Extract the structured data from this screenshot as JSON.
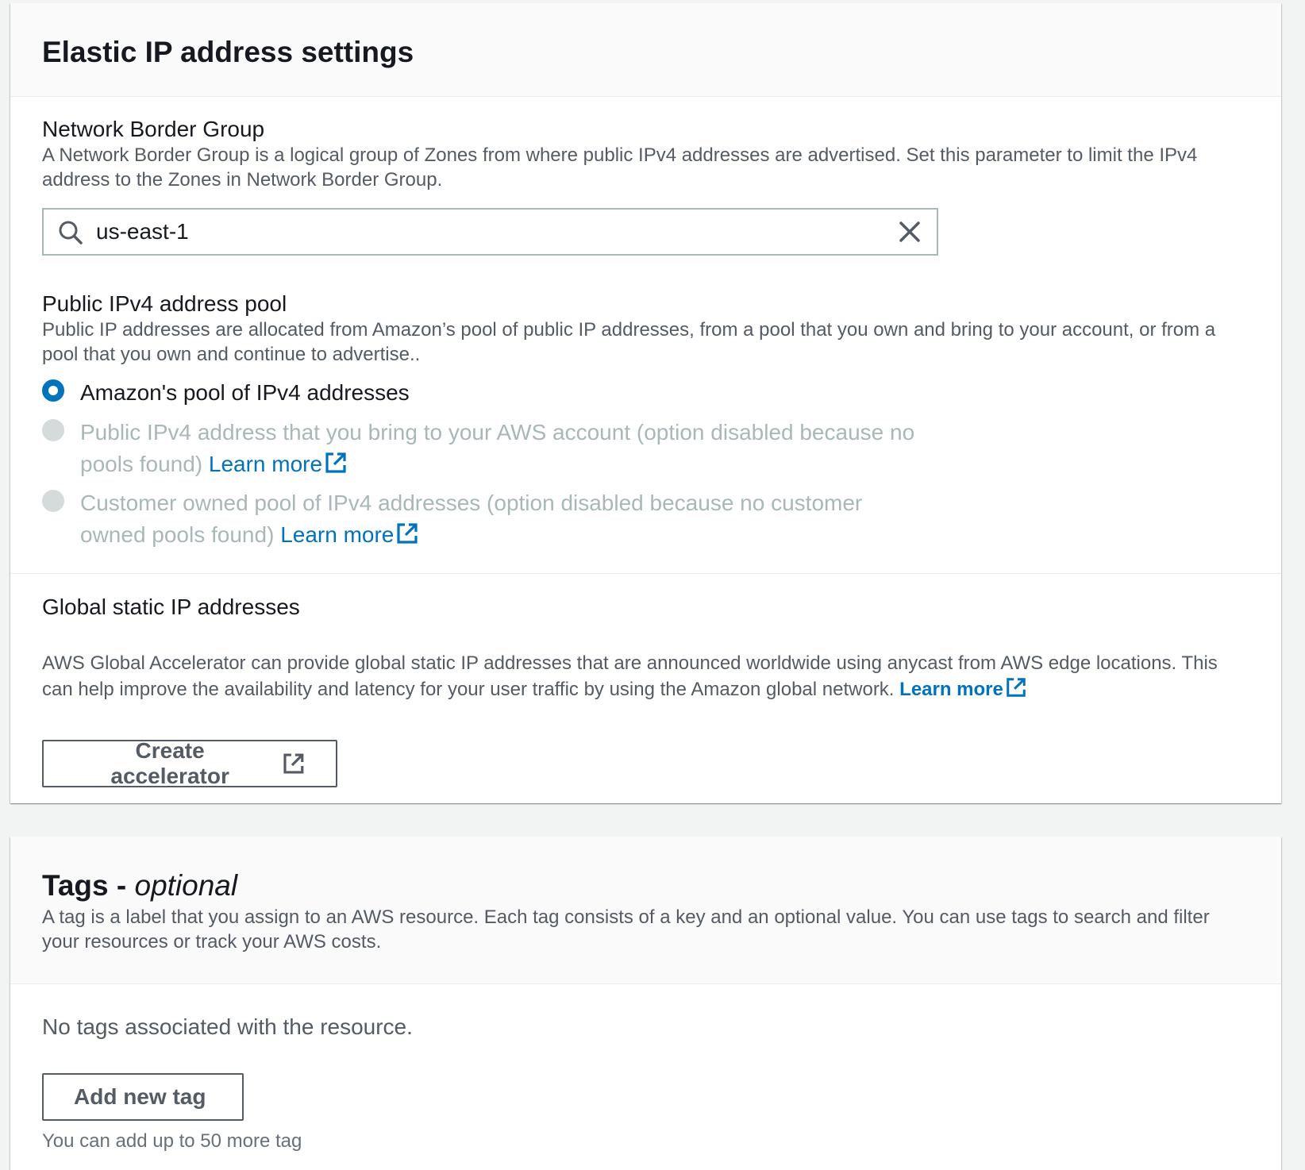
{
  "eip_section": {
    "title": "Elastic IP address settings",
    "network_border_group": {
      "label": "Network Border Group",
      "description": "A Network Border Group is a logical group of Zones from where public IPv4 addresses are advertised. Set this parameter to limit the IPv4 address to the Zones in Network Border Group.",
      "value": "us-east-1",
      "search_icon": "search-icon",
      "clear_icon": "close-icon"
    },
    "ipv4_pool": {
      "label": "Public IPv4 address pool",
      "description": "Public IP addresses are allocated from Amazon’s pool of public IP addresses, from a pool that you own and bring to your account, or from a pool that you own and continue to advertise..",
      "options": [
        {
          "label": "Amazon's pool of IPv4 addresses",
          "checked": true,
          "disabled": false
        },
        {
          "label_line1": "Public IPv4 address that you bring to your AWS account (option disabled because no",
          "label_line2": "pools found)",
          "link": "Learn more",
          "checked": false,
          "disabled": true
        },
        {
          "label_line1": "Customer owned pool of IPv4 addresses (option disabled because no customer",
          "label_line2": "owned pools found)",
          "link": "Learn more",
          "checked": false,
          "disabled": true
        }
      ]
    },
    "global_static": {
      "label": "Global static IP addresses",
      "description_line1": "AWS Global Accelerator can provide global static IP addresses that are announced worldwide using anycast from AWS edge locations. This",
      "description_line2": "can help improve the availability and latency for your user traffic by using the Amazon global network.",
      "link": "Learn more",
      "button": "Create accelerator"
    }
  },
  "tags_section": {
    "title": "Tags - ",
    "title_optional": "optional",
    "description": "A tag is a label that you assign to an AWS resource. Each tag consists of a key and an optional value. You can use tags to search and filter your resources or track your AWS costs.",
    "empty_text": "No tags associated with the resource.",
    "button": "Add new tag",
    "hint": "You can add up to 50 more tag"
  },
  "colors": {
    "link": "#0073bb",
    "radio_checked": "#0073bb",
    "disabled_text": "#aab7b8",
    "background": "#f2f3f3"
  }
}
